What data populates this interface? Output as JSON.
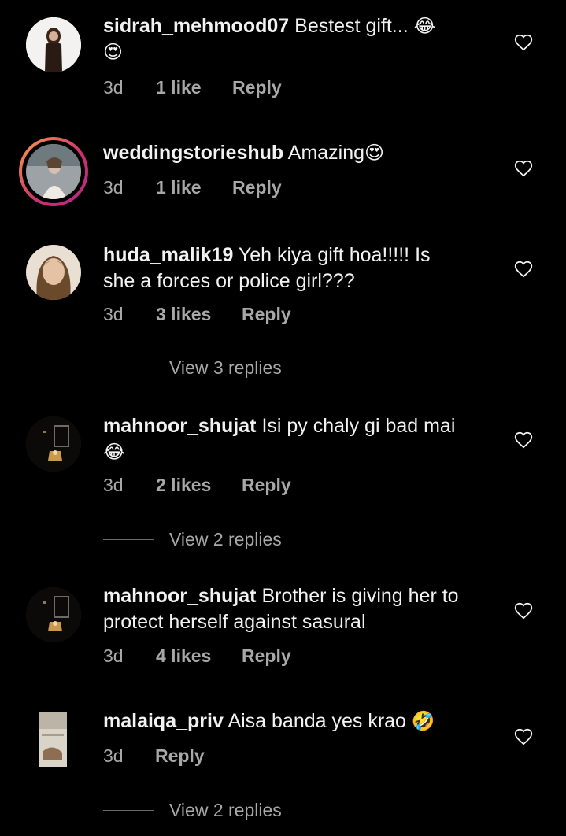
{
  "comments": [
    {
      "username": "sidrah_mehmood07",
      "text": "Bestest gift...",
      "emoji_inline": "😂",
      "emoji_line2": "😍",
      "time": "3d",
      "likes": "1 like",
      "reply": "Reply"
    },
    {
      "username": "weddingstorieshub",
      "text": "Amazing",
      "emoji_inline": "😍",
      "time": "3d",
      "likes": "1 like",
      "reply": "Reply"
    },
    {
      "username": "huda_malik19",
      "text_line1": "Yeh kiya gift hoa!!!!! Is",
      "text_line2": "she a forces or police girl???",
      "time": "3d",
      "likes": "3 likes",
      "reply": "Reply",
      "view_replies": "View 3 replies"
    },
    {
      "username": "mahnoor_shujat",
      "text": "Isi py chaly gi bad mai",
      "emoji_line2": "😂",
      "time": "3d",
      "likes": "2 likes",
      "reply": "Reply",
      "view_replies": "View 2 replies"
    },
    {
      "username": "mahnoor_shujat",
      "text_line1": "Brother is giving her to",
      "text_line2": "protect herself against sasural",
      "time": "3d",
      "likes": "4 likes",
      "reply": "Reply"
    },
    {
      "username": "malaiqa_priv",
      "text": "Aisa banda yes krao",
      "emoji_inline": "🤣",
      "time": "3d",
      "reply": "Reply",
      "view_replies": "View 2 replies"
    }
  ],
  "icons": {
    "like": "heart-outline-icon"
  },
  "colors": {
    "background": "#000000",
    "text": "#f2f2f2",
    "secondary": "#a8a8a8",
    "story_ring": "#d0326d"
  }
}
